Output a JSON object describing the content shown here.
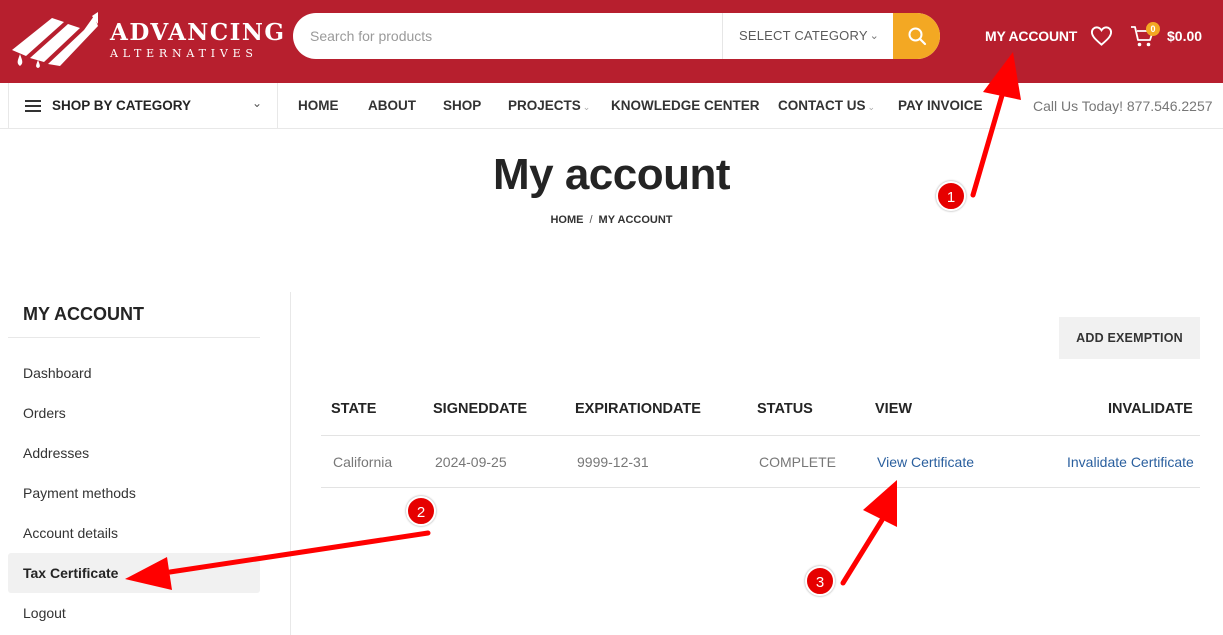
{
  "header": {
    "logo_main": "ADVANCING",
    "logo_sub": "ALTERNATIVES",
    "search_placeholder": "Search for products",
    "select_category": "SELECT CATEGORY",
    "my_account": "MY ACCOUNT",
    "cart_count": "0",
    "cart_total": "$0.00",
    "brand_color": "#b71f2e",
    "accent_color": "#f3a823"
  },
  "nav": {
    "shop_by_category": "SHOP BY CATEGORY",
    "links": [
      "HOME",
      "ABOUT",
      "SHOP",
      "PROJECTS",
      "KNOWLEDGE CENTER",
      "CONTACT US",
      "PAY INVOICE"
    ],
    "call_us": "Call Us Today! 877.546.2257"
  },
  "page": {
    "title": "My account",
    "breadcrumb": [
      "HOME",
      "MY ACCOUNT"
    ]
  },
  "sidebar": {
    "title": "MY ACCOUNT",
    "items": [
      {
        "label": "Dashboard"
      },
      {
        "label": "Orders"
      },
      {
        "label": "Addresses"
      },
      {
        "label": "Payment methods"
      },
      {
        "label": "Account details"
      },
      {
        "label": "Tax Certificate",
        "active": true
      },
      {
        "label": "Logout"
      }
    ]
  },
  "content": {
    "add_button": "ADD EXEMPTION",
    "columns": [
      "STATE",
      "SIGNEDDATE",
      "EXPIRATIONDATE",
      "STATUS",
      "VIEW",
      "INVALIDATE"
    ],
    "rows": [
      {
        "state": "California",
        "signed": "2024-09-25",
        "expiration": "9999-12-31",
        "status": "COMPLETE",
        "view": "View Certificate",
        "invalidate": "Invalidate Certificate"
      }
    ]
  },
  "annotations": {
    "badges": [
      "1",
      "2",
      "3"
    ],
    "color": "#e60000"
  }
}
